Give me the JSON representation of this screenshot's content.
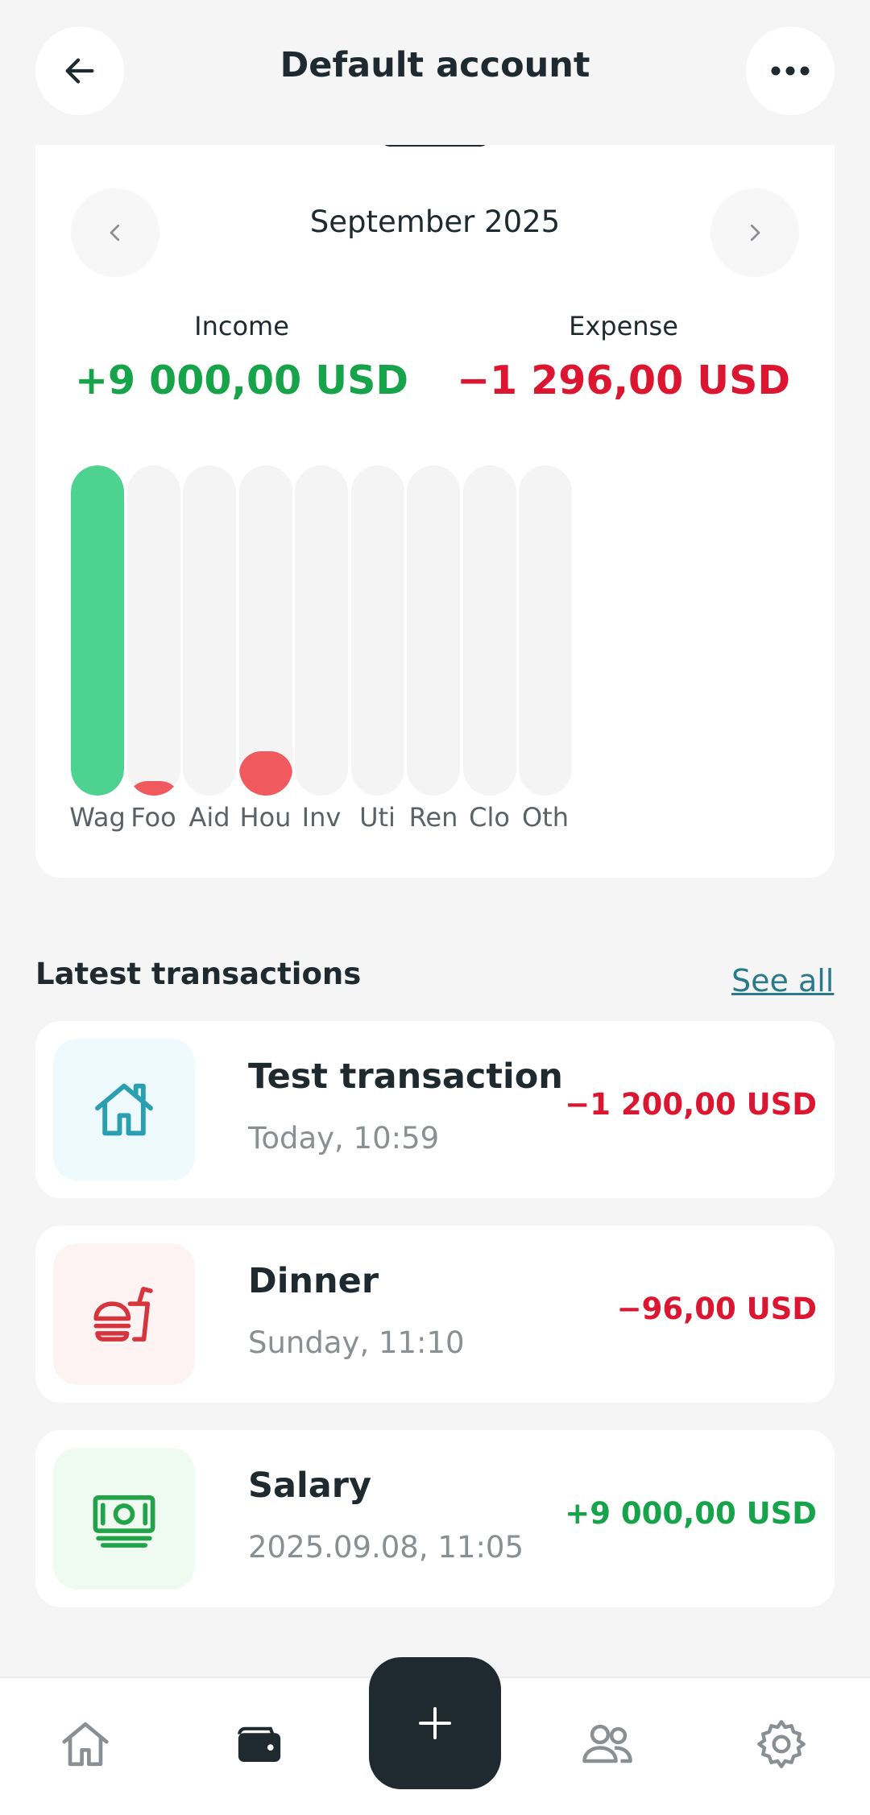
{
  "header": {
    "title": "Default account",
    "back_icon": "arrow-left-icon",
    "more_icon": "more-horizontal-icon"
  },
  "summary": {
    "month": "September 2025",
    "income_label": "Income",
    "income_value": "+9 000,00 USD",
    "expense_label": "Expense",
    "expense_value": "−1 296,00 USD"
  },
  "chart_data": {
    "type": "bar",
    "categories": [
      "Wag",
      "Foo",
      "Aid",
      "Hou",
      "Inv",
      "Uti",
      "Ren",
      "Clo",
      "Oth"
    ],
    "values": [
      9000,
      96,
      0,
      1200,
      0,
      0,
      0,
      0,
      0
    ],
    "colors": [
      "#4dd28f",
      "#f05a5e",
      "#f05a5e",
      "#f05a5e",
      "#f05a5e",
      "#f05a5e",
      "#f05a5e",
      "#f05a5e",
      "#f05a5e"
    ],
    "ylim": [
      0,
      9000
    ],
    "grid": false,
    "title": "",
    "xlabel": "",
    "ylabel": ""
  },
  "transactions_section": {
    "title": "Latest transactions",
    "see_all": "See all"
  },
  "transactions": [
    {
      "title": "Test transaction",
      "subtitle": "Today, 10:59",
      "amount": "−1 200,00 USD",
      "sign": "negative",
      "icon": "house-icon",
      "icon_bg": "#eefafd",
      "icon_color": "#2a9fb2"
    },
    {
      "title": "Dinner",
      "subtitle": "Sunday, 11:10",
      "amount": "−96,00 USD",
      "sign": "negative",
      "icon": "fast-food-icon",
      "icon_bg": "#fdf3f3",
      "icon_color": "#d6353d"
    },
    {
      "title": "Salary",
      "subtitle": "2025.09.08, 11:05",
      "amount": "+9 000,00 USD",
      "sign": "positive",
      "icon": "money-banknote-icon",
      "icon_bg": "#effaf1",
      "icon_color": "#22a34a"
    }
  ],
  "bottom_nav": {
    "items": [
      "home-icon",
      "wallet-icon",
      "add-icon",
      "people-icon",
      "settings-icon"
    ],
    "active": "wallet-icon"
  }
}
